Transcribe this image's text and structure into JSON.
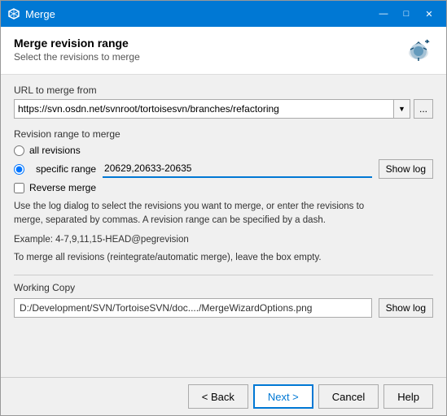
{
  "window": {
    "title": "Merge"
  },
  "header": {
    "title": "Merge revision range",
    "subtitle": "Select the revisions to merge"
  },
  "url_section": {
    "label": "URL to merge from",
    "value": "https://svn.osdn.net/svnroot/tortoisesvn/branches/refactoring",
    "browse_label": "..."
  },
  "revision_section": {
    "label": "Revision range to merge",
    "all_revisions_label": "all revisions",
    "specific_range_label": "specific range",
    "specific_range_value": "20629,20633-20635",
    "show_log_label": "Show log",
    "reverse_merge_label": "Reverse merge"
  },
  "help": {
    "line1": "Use the log dialog to select the revisions you want to merge, or enter the revisions to",
    "line2": "merge, separated by commas. A revision range can be specified by a dash.",
    "example": "Example: 4-7,9,11,15-HEAD@pegrevision",
    "note": "To merge all revisions (reintegrate/automatic merge), leave the box empty."
  },
  "working_copy": {
    "label": "Working Copy",
    "path": "D:/Development/SVN/TortoiseSVN/doc..../MergeWizardOptions.png",
    "show_log_label": "Show log"
  },
  "footer": {
    "back_label": "< Back",
    "next_label": "Next >",
    "cancel_label": "Cancel",
    "help_label": "Help"
  }
}
